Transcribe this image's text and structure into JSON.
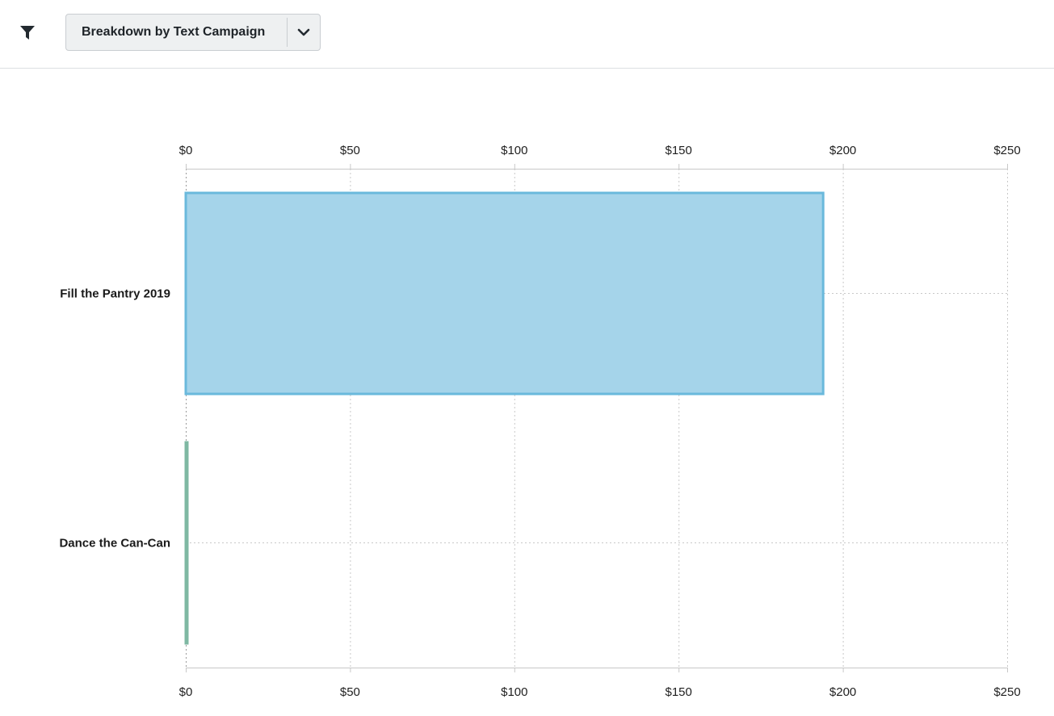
{
  "toolbar": {
    "filter_icon": "filter-icon",
    "breakdown_label": "Breakdown by Text Campaign",
    "dropdown_icon": "chevron-down-icon"
  },
  "chart_data": {
    "type": "bar",
    "orientation": "horizontal",
    "categories": [
      "Fill the Pantry 2019",
      "Dance the Can-Can"
    ],
    "values": [
      194,
      0
    ],
    "xlim": [
      0,
      250
    ],
    "x_ticks": [
      "$0",
      "$50",
      "$100",
      "$150",
      "$200",
      "$250"
    ],
    "x_tick_values": [
      0,
      50,
      100,
      150,
      200,
      250
    ],
    "title": "",
    "xlabel": "",
    "ylabel": "",
    "grid": true,
    "colors": {
      "bar_fills": [
        "#a5d4ea",
        "#b7dccd"
      ],
      "bar_strokes": [
        "#6ab9dc",
        "#7fb8a3"
      ],
      "grid": "#c8c8c8",
      "axis": "#c8c8c8"
    }
  }
}
